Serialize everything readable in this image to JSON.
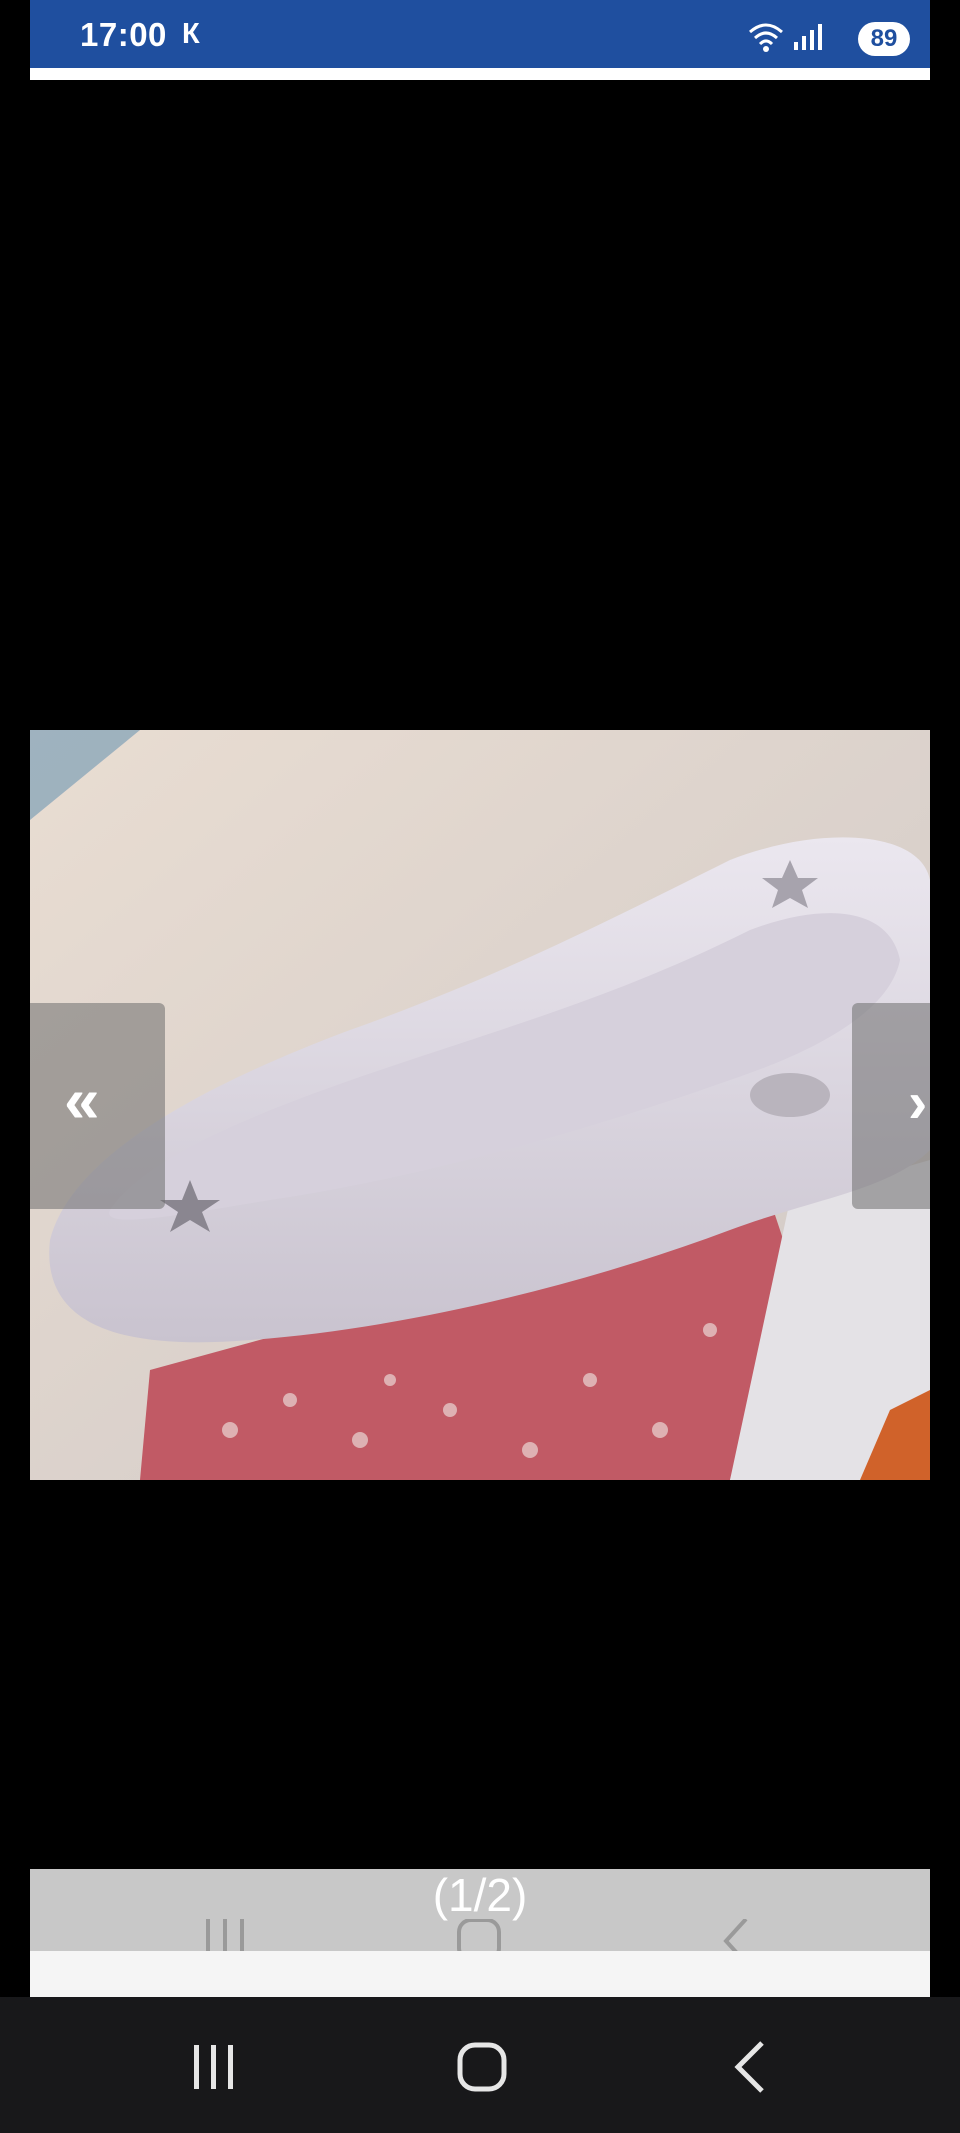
{
  "status_bar": {
    "time": "17:00",
    "carrier_indicator": "К",
    "wifi_icon": "wifi-icon",
    "signal_icon": "signal-icon",
    "battery_level": "89"
  },
  "viewer": {
    "prev_label": "«",
    "next_label": "›",
    "counter": "(1/2)"
  },
  "system_nav": {
    "recents_icon": "recents-icon",
    "home_icon": "home-icon",
    "back_icon": "back-icon"
  },
  "colors": {
    "status_bar_bg": "#1f4f9f",
    "viewer_bg": "#000000",
    "counter_bar_bg": "#c8c8c8",
    "system_nav_bg": "#18181a"
  }
}
